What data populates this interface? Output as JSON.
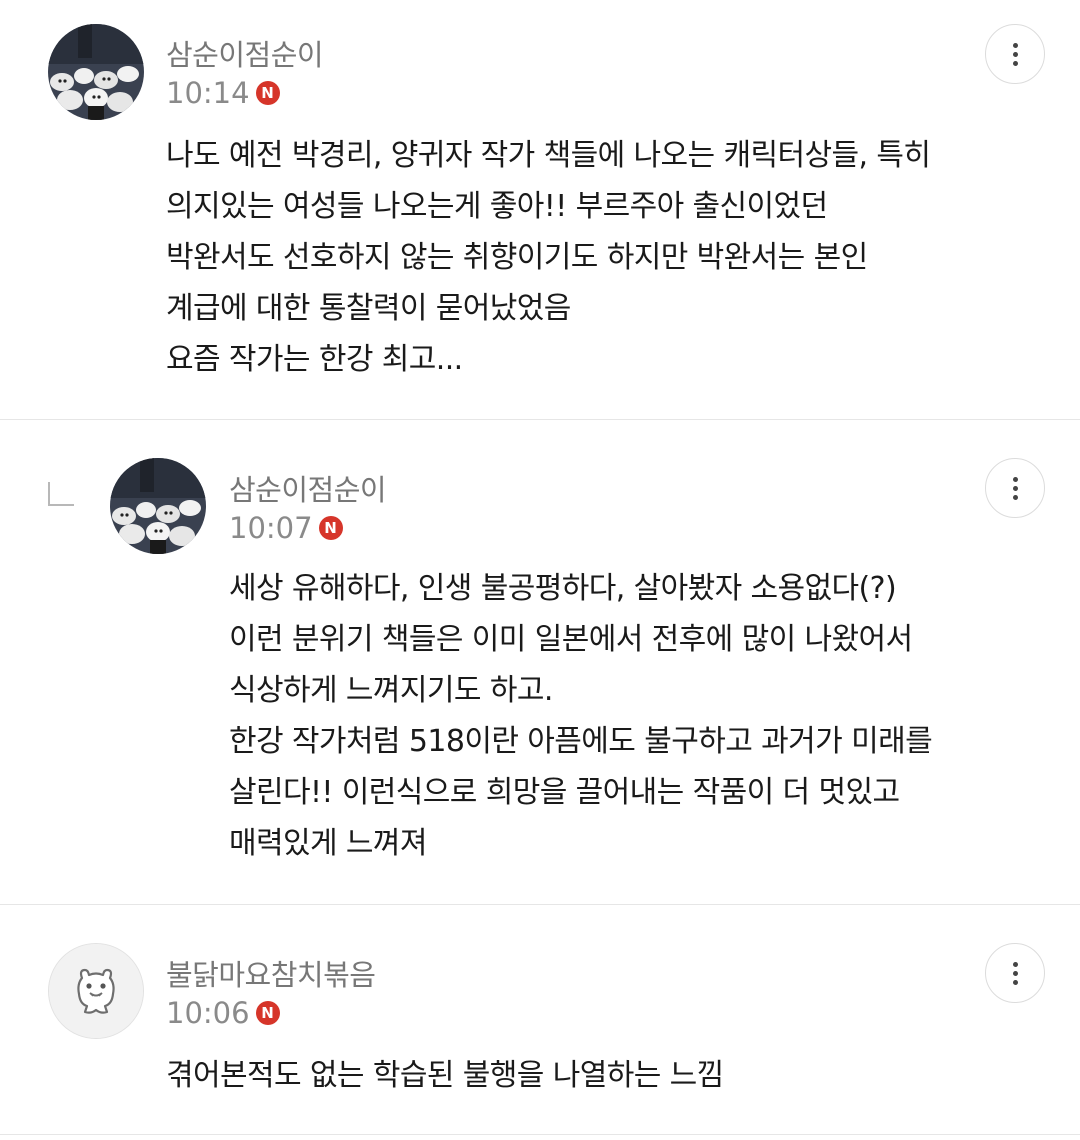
{
  "comments": [
    {
      "author": "삼순이점순이",
      "time": "10:14",
      "badge": "N",
      "avatar": "crowd-photo-avatar",
      "is_reply": false,
      "lines": [
        "나도 예전 박경리, 양귀자 작가 책들에 나오는 캐릭터상들, 특히",
        "의지있는 여성들 나오는게 좋아!! 부르주아 출신이었던",
        "박완서도 선호하지 않는 취향이기도 하지만 박완서는 본인",
        "계급에 대한 통찰력이 묻어났었음",
        "요즘 작가는 한강 최고..."
      ]
    },
    {
      "author": "삼순이점순이",
      "time": "10:07",
      "badge": "N",
      "avatar": "crowd-photo-avatar",
      "is_reply": true,
      "lines": [
        "세상 유해하다, 인생 불공평하다, 살아봤자 소용없다(?)",
        "이런 분위기 책들은 이미 일본에서 전후에 많이 나왔어서",
        "식상하게 느껴지기도 하고.",
        "한강 작가처럼 518이란 아픔에도 불구하고 과거가 미래를",
        "살린다!! 이런식으로 희망을 끌어내는 작품이 더 멋있고",
        "매력있게 느껴져"
      ]
    },
    {
      "author": "불닭마요참치볶음",
      "time": "10:06",
      "badge": "N",
      "avatar": "default-character-avatar",
      "is_reply": false,
      "lines": [
        "겪어본적도 없는 학습된 불행을 나열하는 느낌"
      ]
    }
  ],
  "icons": {
    "more": "vertical-ellipsis-icon",
    "reply": "reply-corner-icon",
    "new_badge": "new-badge-icon"
  },
  "colors": {
    "badge": "#d6352a",
    "author": "#777777",
    "time": "#8a8a8a",
    "body": "#1a1a1a",
    "separator": "#e6e6e6"
  }
}
